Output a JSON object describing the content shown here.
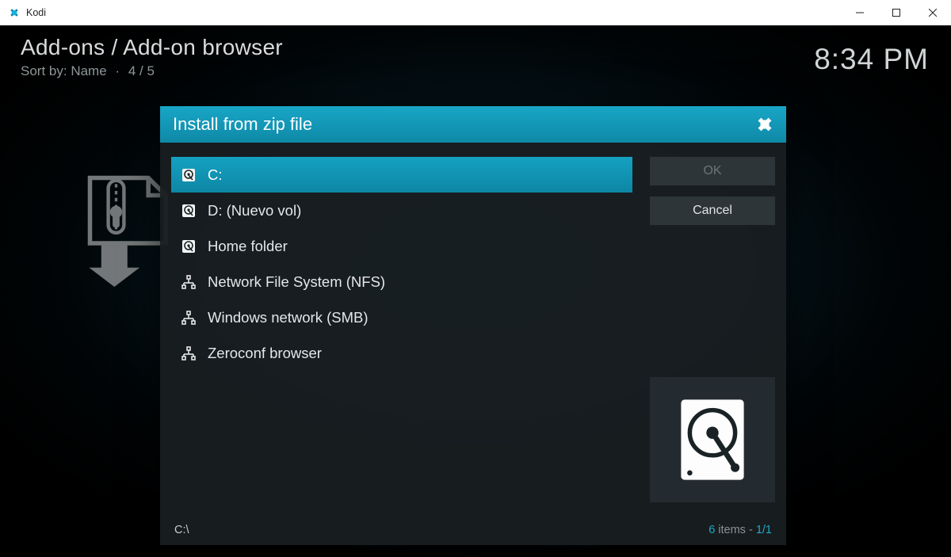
{
  "window": {
    "title": "Kodi"
  },
  "header": {
    "breadcrumb": "Add-ons / Add-on browser",
    "sort_prefix": "Sort by:",
    "sort_value": "Name",
    "sort_count": "4 / 5",
    "clock": "8:34 PM"
  },
  "dialog": {
    "title": "Install from zip file",
    "items": [
      {
        "label": "C:",
        "icon": "drive",
        "selected": true
      },
      {
        "label": "D: (Nuevo vol)",
        "icon": "drive",
        "selected": false
      },
      {
        "label": "Home folder",
        "icon": "drive",
        "selected": false
      },
      {
        "label": "Network File System (NFS)",
        "icon": "network",
        "selected": false
      },
      {
        "label": "Windows network (SMB)",
        "icon": "network",
        "selected": false
      },
      {
        "label": "Zeroconf browser",
        "icon": "network",
        "selected": false
      }
    ],
    "buttons": {
      "ok": "OK",
      "cancel": "Cancel"
    },
    "footer": {
      "path": "C:\\",
      "count": "6",
      "count_suffix": " items - ",
      "page": "1/1"
    }
  }
}
